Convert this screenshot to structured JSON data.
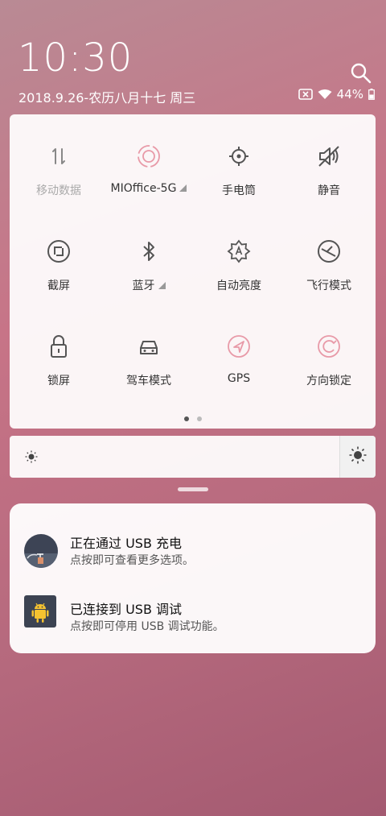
{
  "status": {
    "time": "10:30",
    "date": "2018.9.26-农历八月十七 周三",
    "battery": "44%",
    "icons": [
      "search-icon",
      "sim-none-icon",
      "wifi-icon",
      "battery-icon"
    ]
  },
  "quick_settings": {
    "tiles": [
      {
        "label": "移动数据",
        "icon": "mobile-data-icon",
        "active": false,
        "dim": true
      },
      {
        "label": "MIOffice-5G",
        "icon": "wifi-tile-icon",
        "active": true
      },
      {
        "label": "手电筒",
        "icon": "flashlight-icon",
        "active": false
      },
      {
        "label": "静音",
        "icon": "mute-icon",
        "active": false
      },
      {
        "label": "截屏",
        "icon": "screenshot-icon",
        "active": false
      },
      {
        "label": "蓝牙",
        "icon": "bluetooth-icon",
        "active": false
      },
      {
        "label": "自动亮度",
        "icon": "auto-brightness-icon",
        "active": false
      },
      {
        "label": "飞行模式",
        "icon": "airplane-mode-icon",
        "active": false
      },
      {
        "label": "锁屏",
        "icon": "lock-icon",
        "active": false
      },
      {
        "label": "驾车模式",
        "icon": "car-icon",
        "active": false
      },
      {
        "label": "GPS",
        "icon": "gps-icon",
        "active": true
      },
      {
        "label": "方向锁定",
        "icon": "rotation-lock-icon",
        "active": true
      }
    ],
    "page_indicator": {
      "pages": 2,
      "current": 1
    }
  },
  "brightness": {
    "icon_low": "brightness-low-icon",
    "icon_high": "brightness-high-icon"
  },
  "notifications": [
    {
      "title": "正在通过  USB  充电",
      "subtitle": "点按即可查看更多选项。",
      "icon": "usb-charging-icon"
    },
    {
      "title": "已连接到  USB  调试",
      "subtitle": "点按即可停用 USB 调试功能。",
      "icon": "android-debug-icon"
    }
  ],
  "colors": {
    "accent_pink": "#e89aa8",
    "icon_gray": "#555555"
  }
}
